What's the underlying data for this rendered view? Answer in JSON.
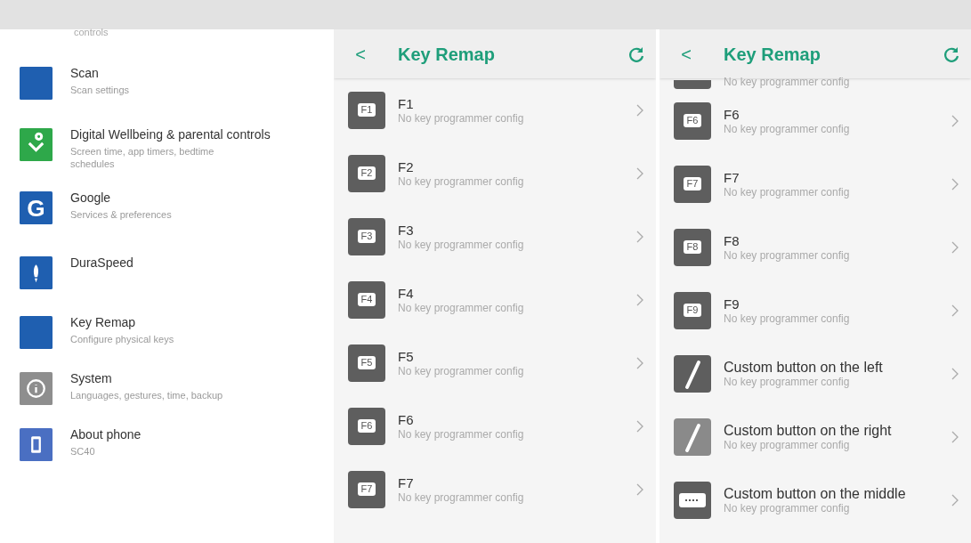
{
  "settings": {
    "cut_text": "controls",
    "items": [
      {
        "kind": "scan",
        "color": "#1f5fb0",
        "title": "Scan",
        "subtitle": "Scan settings"
      },
      {
        "kind": "wellbeing",
        "color": "#2ea84a",
        "title": "Digital Wellbeing & parental controls",
        "subtitle": "Screen time, app timers, bedtime schedules"
      },
      {
        "kind": "letter",
        "glyph": "G",
        "color": "#1f5fb0",
        "title": "Google",
        "subtitle": "Services & preferences"
      },
      {
        "kind": "rocket",
        "color": "#1f5fb0",
        "title": "DuraSpeed"
      },
      {
        "kind": "blank",
        "color": "#1f5fb0",
        "title": "Key Remap",
        "subtitle": "Configure physical keys"
      },
      {
        "kind": "info",
        "color": "#8e8e8e",
        "title": "System",
        "subtitle": "Languages, gestures, time, backup"
      },
      {
        "kind": "phone",
        "color": "#4a6fc2",
        "title": "About phone",
        "subtitle": "SC40"
      }
    ]
  },
  "panels": [
    {
      "back": "<",
      "title": "Key Remap",
      "rows": [
        {
          "kind": "key",
          "key_label": "F1",
          "title": "F1",
          "subtitle": "No key programmer config"
        },
        {
          "kind": "key",
          "key_label": "F2",
          "title": "F2",
          "subtitle": "No key programmer config"
        },
        {
          "kind": "key",
          "key_label": "F3",
          "title": "F3",
          "subtitle": "No key programmer config"
        },
        {
          "kind": "key",
          "key_label": "F4",
          "title": "F4",
          "subtitle": "No key programmer config"
        },
        {
          "kind": "key",
          "key_label": "F5",
          "title": "F5",
          "subtitle": "No key programmer config"
        },
        {
          "kind": "key",
          "key_label": "F6",
          "title": "F6",
          "subtitle": "No key programmer config"
        },
        {
          "kind": "key",
          "key_label": "F7",
          "title": "F7",
          "subtitle": "No key programmer config"
        }
      ]
    },
    {
      "back": "<",
      "title": "Key Remap",
      "rows": [
        {
          "kind": "partial",
          "subtitle": "No key programmer config"
        },
        {
          "kind": "key",
          "key_label": "F6",
          "title": "F6",
          "subtitle": "No key programmer config"
        },
        {
          "kind": "key",
          "key_label": "F7",
          "title": "F7",
          "subtitle": "No key programmer config"
        },
        {
          "kind": "key",
          "key_label": "F8",
          "title": "F8",
          "subtitle": "No key programmer config"
        },
        {
          "kind": "key",
          "key_label": "F9",
          "title": "F9",
          "subtitle": "No key programmer config"
        },
        {
          "kind": "slash_dark",
          "title": "Custom button on the left",
          "subtitle": "No key programmer config"
        },
        {
          "kind": "slash_light",
          "title": "Custom button on the right",
          "subtitle": "No key programmer config"
        },
        {
          "kind": "dots",
          "title": "Custom button on the middle",
          "subtitle": "No key programmer config"
        }
      ]
    }
  ]
}
